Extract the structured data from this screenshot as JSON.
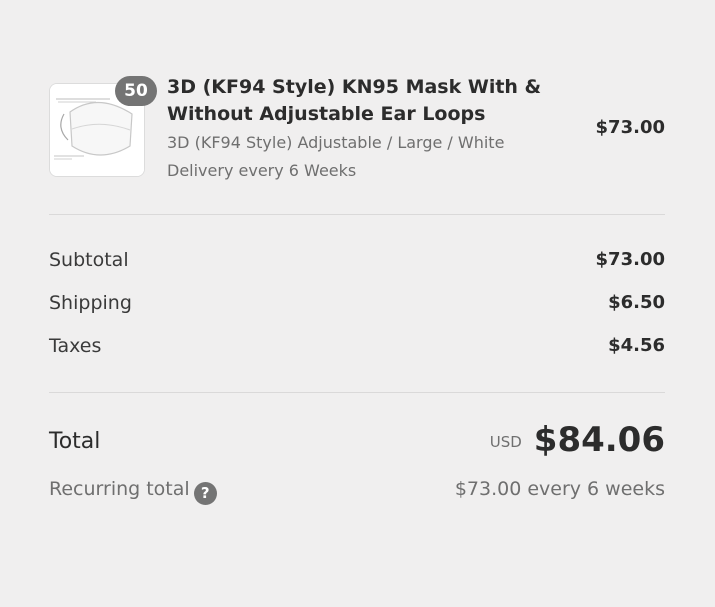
{
  "product": {
    "quantity": "50",
    "title": "3D (KF94 Style) KN95 Mask With & Without Adjustable Ear Loops",
    "variant": "3D (KF94 Style) Adjustable / Large / White",
    "delivery": "Delivery every 6 Weeks",
    "price": "$73.00",
    "image_icon": "mask-product-image"
  },
  "costs": {
    "subtotal_label": "Subtotal",
    "subtotal_value": "$73.00",
    "shipping_label": "Shipping",
    "shipping_value": "$6.50",
    "taxes_label": "Taxes",
    "taxes_value": "$4.56"
  },
  "total": {
    "label": "Total",
    "currency": "USD",
    "amount": "$84.06"
  },
  "recurring": {
    "label": "Recurring total",
    "help_icon": "?",
    "value": "$73.00 every 6 weeks"
  },
  "colors": {
    "background": "#f0efef",
    "badge": "#747474",
    "text_dark": "#2c2c2c",
    "text_muted": "#6f6f6f",
    "divider": "#dad9d9"
  }
}
